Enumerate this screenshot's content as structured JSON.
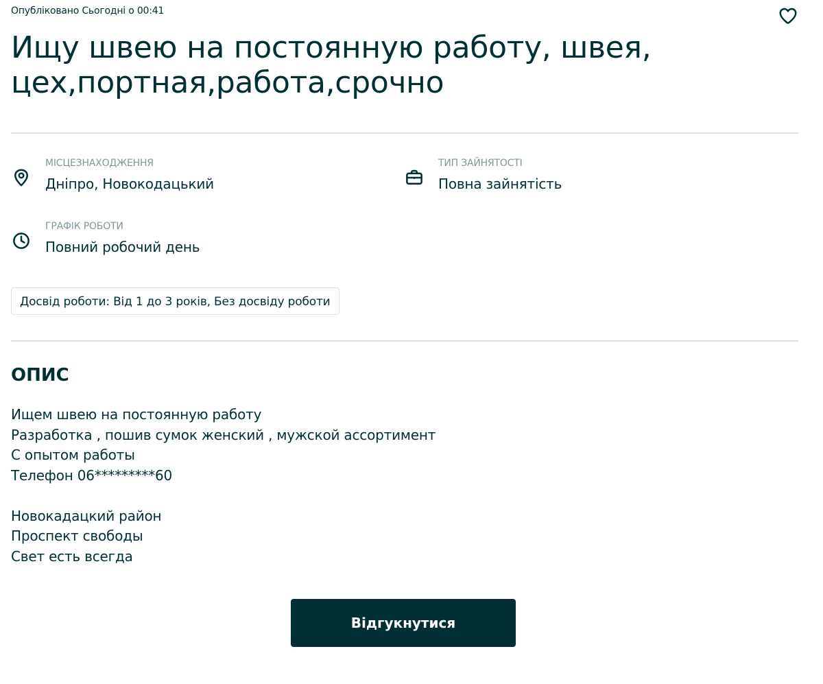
{
  "header": {
    "published": "Опубліковано Сьогодні о 00:41",
    "favorite_icon": "heart-icon"
  },
  "listing": {
    "title_line1": "Ищу швею на постоянную работу, швея,",
    "title_line2": "цех,портная,работа,срочно"
  },
  "attributes": {
    "location": {
      "icon": "location-pin-icon",
      "label": "Місцезнаходження",
      "value": "Дніпро, Новокодацький"
    },
    "employment_type": {
      "icon": "briefcase-icon",
      "label": "Тип зайнятості",
      "value": "Повна зайнятість"
    },
    "schedule": {
      "icon": "clock-icon",
      "label": "Графік роботи",
      "value": "Повний робочий день"
    }
  },
  "experience_tag": "Досвід роботи: Від 1 до 3 років, Без досвіду роботи",
  "description": {
    "title": "Опис",
    "lines": [
      "Ищем швею на постоянную работу",
      "Разработка , пошив сумок женский , мужской ассортимент",
      "С опытом работы",
      "Телефон 06*********60",
      "",
      "Новокадацкий район",
      "Проспект свободы",
      "Свет есть всегда"
    ]
  },
  "actions": {
    "apply_label": "Відгукнутися"
  },
  "colors": {
    "text": "#002f34",
    "muted": "#7f9799",
    "divider": "#d8e3e4",
    "button_bg": "#002f34",
    "button_text": "#ffffff"
  }
}
